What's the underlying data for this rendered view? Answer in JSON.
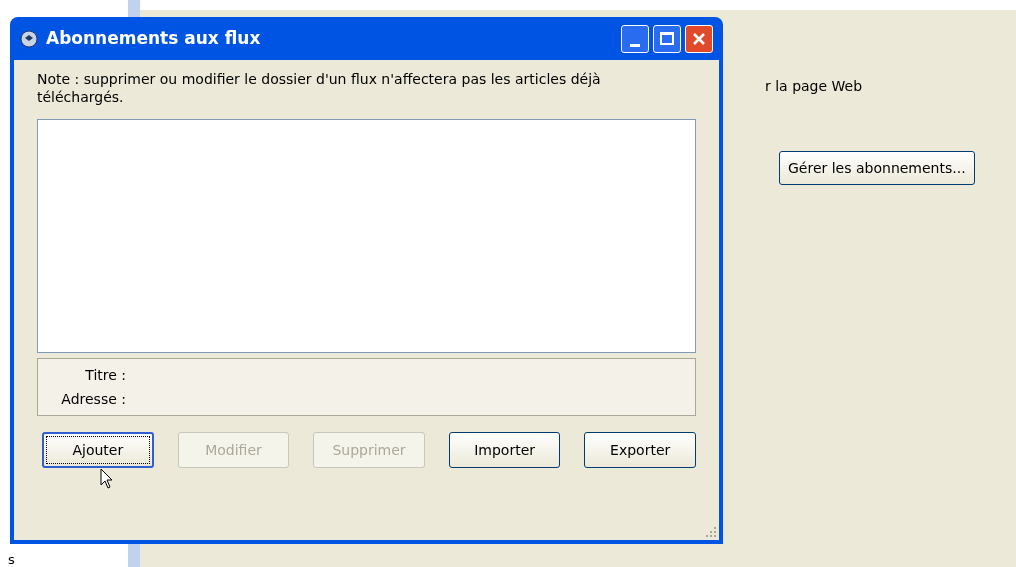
{
  "background": {
    "text": "r la page Web",
    "button": "Gérer les abonnements...",
    "footer_text": "s"
  },
  "window": {
    "title": "Abonnements aux flux"
  },
  "note": "Note : supprimer ou modifier le dossier d'un flux n'affectera pas les articles déjà téléchargés.",
  "details": [
    {
      "label": "Titre :"
    },
    {
      "label": "Adresse :"
    }
  ],
  "buttons": [
    {
      "label": "Ajouter",
      "disabled": false,
      "default": true
    },
    {
      "label": "Modifier",
      "disabled": true,
      "default": false
    },
    {
      "label": "Supprimer",
      "disabled": true,
      "default": false
    },
    {
      "label": "Importer",
      "disabled": false,
      "default": false
    },
    {
      "label": "Exporter",
      "disabled": false,
      "default": false
    }
  ]
}
